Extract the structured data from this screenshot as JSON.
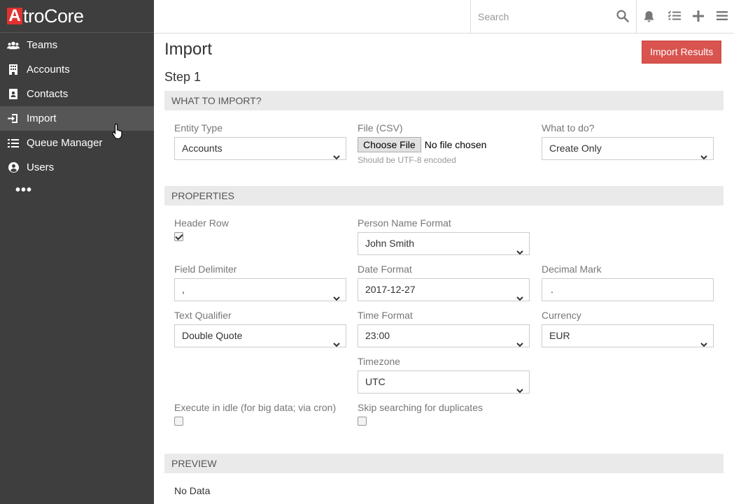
{
  "logo": {
    "mark": "A",
    "text": "troCore"
  },
  "sidebar": {
    "items": [
      {
        "label": "Teams",
        "icon": "users-icon"
      },
      {
        "label": "Accounts",
        "icon": "building-icon"
      },
      {
        "label": "Contacts",
        "icon": "address-card-icon"
      },
      {
        "label": "Import",
        "icon": "sign-in-icon",
        "active": true
      },
      {
        "label": "Queue Manager",
        "icon": "list-check-icon"
      },
      {
        "label": "Users",
        "icon": "user-circle-icon"
      }
    ],
    "more": "•••"
  },
  "topbar": {
    "search_placeholder": "Search"
  },
  "page": {
    "title": "Import",
    "results_button": "Import Results",
    "step": "Step 1"
  },
  "what_to_import": {
    "header": "WHAT TO IMPORT?",
    "entity_type": {
      "label": "Entity Type",
      "value": "Accounts"
    },
    "file": {
      "label": "File (CSV)",
      "button": "Choose File",
      "status": "No file chosen",
      "hint": "Should be UTF-8 encoded"
    },
    "what_to_do": {
      "label": "What to do?",
      "value": "Create Only"
    }
  },
  "properties": {
    "header": "PROPERTIES",
    "header_row": {
      "label": "Header Row",
      "checked": true
    },
    "person_name_format": {
      "label": "Person Name Format",
      "value": "John Smith"
    },
    "field_delimiter": {
      "label": "Field Delimiter",
      "value": ","
    },
    "date_format": {
      "label": "Date Format",
      "value": "2017-12-27"
    },
    "decimal_mark": {
      "label": "Decimal Mark",
      "value": "."
    },
    "text_qualifier": {
      "label": "Text Qualifier",
      "value": "Double Quote"
    },
    "time_format": {
      "label": "Time Format",
      "value": "23:00"
    },
    "currency": {
      "label": "Currency",
      "value": "EUR"
    },
    "timezone": {
      "label": "Timezone",
      "value": "UTC"
    },
    "execute_idle": {
      "label": "Execute in idle (for big data; via cron)",
      "checked": false
    },
    "skip_duplicates": {
      "label": "Skip searching for duplicates",
      "checked": false
    }
  },
  "preview": {
    "header": "PREVIEW",
    "empty_text": "No Data"
  },
  "colors": {
    "sidebar_bg": "#3e3e3e",
    "sidebar_active": "#565656",
    "accent_red": "#d9534f",
    "logo_red": "#e03131"
  }
}
